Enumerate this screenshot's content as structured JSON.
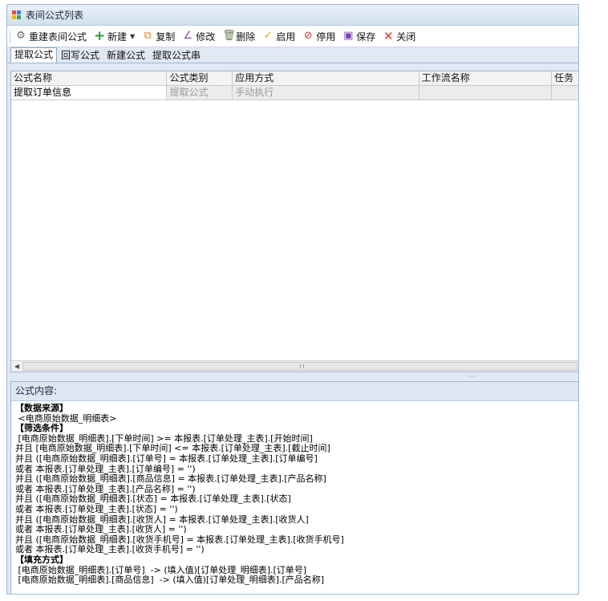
{
  "window": {
    "title": "表间公式列表"
  },
  "toolbar": {
    "rebuild_label": "重建表间公式",
    "new_label": "新建",
    "copy_label": "复制",
    "edit_label": "修改",
    "delete_label": "删除",
    "enable_label": "启用",
    "disable_label": "停用",
    "save_label": "保存",
    "close_label": "关闭"
  },
  "tabs": [
    {
      "label": "提取公式",
      "active": true
    },
    {
      "label": "回写公式",
      "active": false
    },
    {
      "label": "新建公式",
      "active": false
    },
    {
      "label": "提取公式串",
      "active": false
    }
  ],
  "grid": {
    "columns": [
      "公式名称",
      "公式类别",
      "应用方式",
      "工作流名称",
      "任务"
    ],
    "rows": [
      [
        "提取订单信息",
        "提取公式",
        "手动执行",
        "",
        ""
      ]
    ]
  },
  "formula_panel": {
    "title": "公式内容:",
    "lines": [
      "【数据来源】",
      " <电商原始数据_明细表>",
      "【筛选条件】",
      " [电商原始数据_明细表].[下单时间] >= 本报表.[订单处理_主表].[开始时间]",
      "并且 [电商原始数据_明细表].[下单时间] <= 本报表.[订单处理_主表].[截止时间]",
      "并且 ([电商原始数据_明细表].[订单号] = 本报表.[订单处理_主表].[订单编号]",
      "或者 本报表.[订单处理_主表].[订单编号] = '')",
      "并且 ([电商原始数据_明细表].[商品信息] = 本报表.[订单处理_主表].[产品名称]",
      "或者 本报表.[订单处理_主表].[产品名称] = '')",
      "并且 ([电商原始数据_明细表].[状态] = 本报表.[订单处理_主表].[状态]",
      "或者 本报表.[订单处理_主表].[状态] = '')",
      "并且 ([电商原始数据_明细表].[收货人] = 本报表.[订单处理_主表].[收货人]",
      "或者 本报表.[订单处理_主表].[收货人] = '')",
      "并且 ([电商原始数据_明细表].[收货手机号] = 本报表.[订单处理_主表].[收货手机号]",
      "或者 本报表.[订单处理_主表].[收货手机号] = '')",
      "【填充方式】",
      " [电商原始数据_明细表].[订单号]  -> (填入值)[订单处理_明细表].[订单号]",
      " [电商原始数据_明细表].[商品信息]  -> (填入值)[订单处理_明细表].[产品名称]"
    ]
  },
  "colors": {
    "accent": "#3b8a3a",
    "danger": "#d83b2a",
    "header_bg": "#dfe8f3"
  }
}
